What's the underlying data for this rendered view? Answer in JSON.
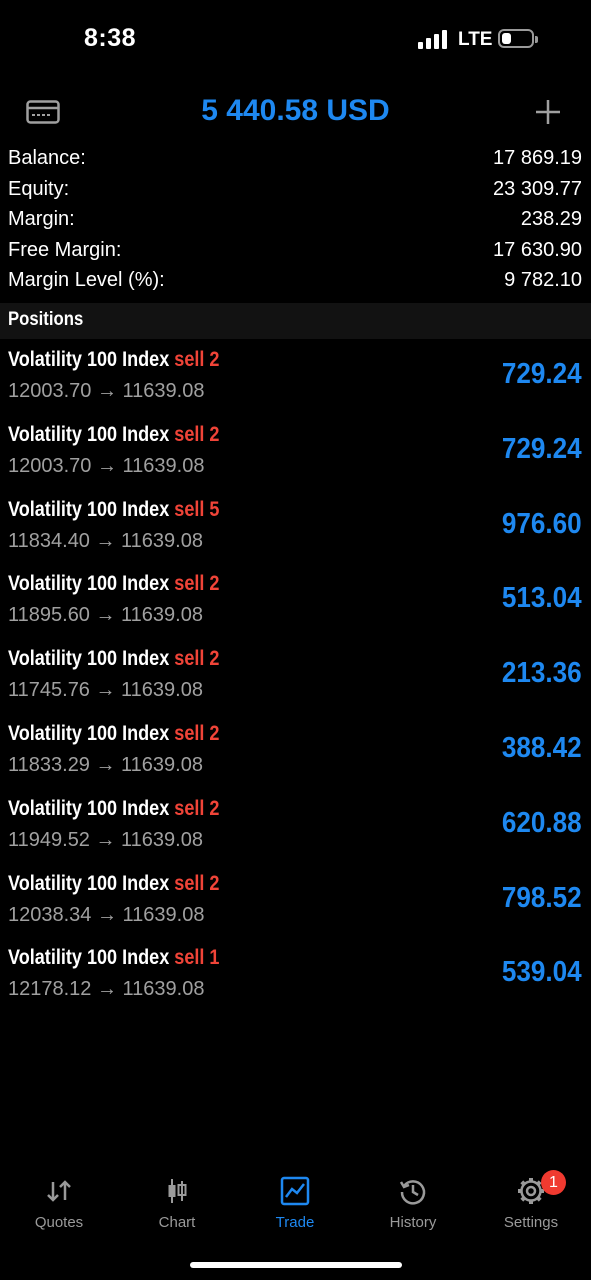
{
  "status_bar": {
    "time": "8:38",
    "network": "LTE"
  },
  "header": {
    "title": "5 440.58 USD",
    "left_icon": "card-icon",
    "right_icon": "plus-icon",
    "accent_color": "#1e88f0"
  },
  "summary": [
    {
      "label": "Balance:",
      "value": "17 869.19"
    },
    {
      "label": "Equity:",
      "value": "23 309.77"
    },
    {
      "label": "Margin:",
      "value": "238.29"
    },
    {
      "label": "Free Margin:",
      "value": "17 630.90"
    },
    {
      "label": "Margin Level (%):",
      "value": "9 782.10"
    }
  ],
  "positions_header": "Positions",
  "positions": [
    {
      "symbol": "Volatility 100 Index",
      "side": "sell 2",
      "prices": "12003.70 → 11639.08",
      "profit": "729.24"
    },
    {
      "symbol": "Volatility 100 Index",
      "side": "sell 2",
      "prices": "12003.70 → 11639.08",
      "profit": "729.24"
    },
    {
      "symbol": "Volatility 100 Index",
      "side": "sell 5",
      "prices": "11834.40 → 11639.08",
      "profit": "976.60"
    },
    {
      "symbol": "Volatility 100 Index",
      "side": "sell 2",
      "prices": "11895.60 → 11639.08",
      "profit": "513.04"
    },
    {
      "symbol": "Volatility 100 Index",
      "side": "sell 2",
      "prices": "11745.76 → 11639.08",
      "profit": "213.36"
    },
    {
      "symbol": "Volatility 100 Index",
      "side": "sell 2",
      "prices": "11833.29 → 11639.08",
      "profit": "388.42"
    },
    {
      "symbol": "Volatility 100 Index",
      "side": "sell 2",
      "prices": "11949.52 → 11639.08",
      "profit": "620.88"
    },
    {
      "symbol": "Volatility 100 Index",
      "side": "sell 2",
      "prices": "12038.34 → 11639.08",
      "profit": "798.52"
    },
    {
      "symbol": "Volatility 100 Index",
      "side": "sell 1",
      "prices": "12178.12 → 11639.08",
      "profit": "539.04"
    }
  ],
  "tabs": [
    {
      "label": "Quotes",
      "icon": "quotes-icon",
      "active": false
    },
    {
      "label": "Chart",
      "icon": "chart-icon",
      "active": false
    },
    {
      "label": "Trade",
      "icon": "trade-icon",
      "active": true
    },
    {
      "label": "History",
      "icon": "history-icon",
      "active": false
    },
    {
      "label": "Settings",
      "icon": "settings-icon",
      "active": false
    }
  ],
  "settings_badge": "1",
  "colors": {
    "sell": "#f04438",
    "profit": "#1e88f0",
    "muted": "#a0a0a0"
  }
}
